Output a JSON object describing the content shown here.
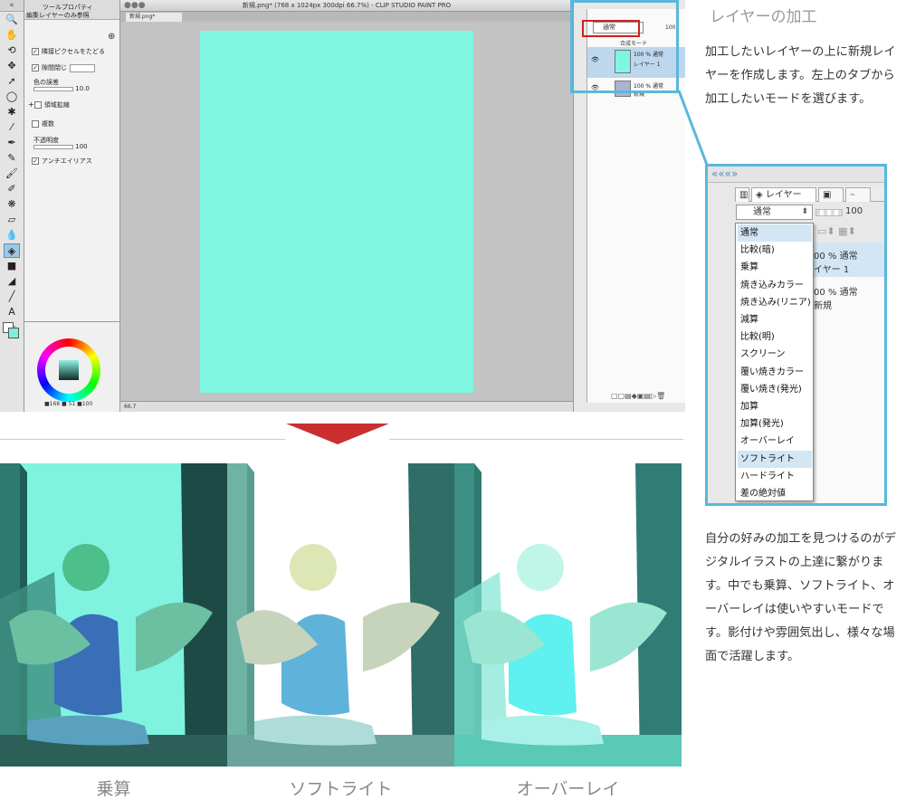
{
  "app": {
    "window_title": "新規.png* (768 x 1024px 300dpi 66.7%)  - CLIP STUDIO PAINT PRO",
    "doc_tab": "新規.png*",
    "status_zoom": "66.7",
    "tool_property": {
      "panel_title": "ツールプロパティ",
      "subtool": "編集レイヤーのみ参照",
      "follow_pixels": "隣接ピクセルをたどる",
      "close_gaps": "隙間閉じ",
      "color_margin_label": "色の誤差",
      "color_margin_value": "10.0",
      "area_scaling": "領域拡縮",
      "multi_ref": "複数",
      "opacity_label": "不透明度",
      "opacity_value": "100",
      "antialias": "アンチエイリアス"
    },
    "color_values": "■168 ■ 51 ■100",
    "layer_panel": {
      "blend_mode": "通常",
      "opacity": "100",
      "blend_label": "合成モード",
      "layers": [
        {
          "meta": "100 % 通常",
          "name": "レイヤー 1"
        },
        {
          "meta": "100 % 通常",
          "name": "新規"
        }
      ]
    }
  },
  "inset": {
    "tab_layer": "レイヤー",
    "blend_mode": "通常",
    "opacity": "100",
    "layer_rows": [
      {
        "meta": "00 % 通常",
        "name": "イヤー 1"
      },
      {
        "meta": "00 % 通常",
        "name": "新規"
      }
    ],
    "blend_modes": [
      "通常",
      "比較(暗)",
      "乗算",
      "焼き込みカラー",
      "焼き込み(リニア)",
      "減算",
      "比較(明)",
      "スクリーン",
      "覆い焼きカラー",
      "覆い焼き(発光)",
      "加算",
      "加算(発光)",
      "オーバーレイ",
      "ソフトライト",
      "ハードライト",
      "差の絶対値"
    ],
    "highlighted": "ソフトライト"
  },
  "text": {
    "heading": "レイヤーの加工",
    "para1": "加工したいレイヤーの上に新規レイヤーを作成します。左上のタブから加工したいモードを選びます。",
    "para2": "自分の好みの加工を見つけるのがデジタルイラストの上達に繋がります。中でも乗算、ソフトライト、オーバーレイは使いやすいモードです。影付けや雰囲気出し、様々な場面で活躍します。"
  },
  "captions": [
    "乗算",
    "ソフトライト",
    "オーバーレイ"
  ],
  "colors": {
    "accent_blue": "#59b8dc",
    "red_marker": "#d02020",
    "fill_cyan": "#7ff6e1"
  }
}
